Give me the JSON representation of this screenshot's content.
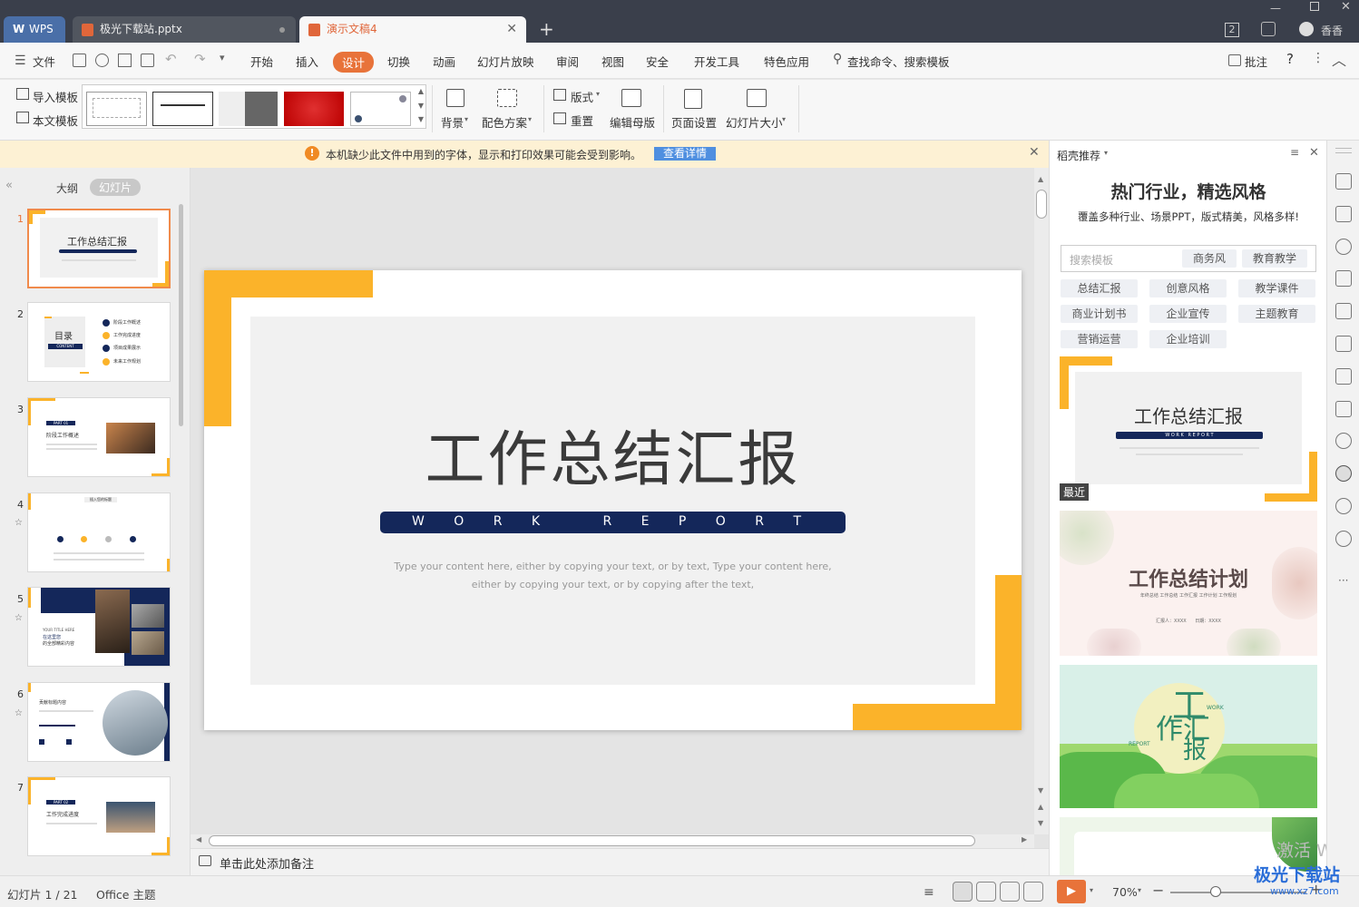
{
  "titlebar": {
    "wps": "WPS",
    "tab1": "极光下载站.pptx",
    "tab2": "演示文稿4",
    "user": "香香",
    "num": "2"
  },
  "menu": {
    "file": "文件",
    "items": [
      "开始",
      "插入",
      "设计",
      "切换",
      "动画",
      "幻灯片放映",
      "审阅",
      "视图",
      "安全",
      "开发工具",
      "特色应用"
    ],
    "search": "查找命令、搜索模板",
    "comment": "批注",
    "help": "?"
  },
  "ribbon": {
    "import": "导入模板",
    "this": "本文模板",
    "bg": "背景",
    "color": "配色方案",
    "layout": "版式",
    "reset": "重置",
    "master": "编辑母版",
    "pagesetup": "页面设置",
    "size": "幻灯片大小"
  },
  "warning": {
    "text": "本机缺少此文件中用到的字体，显示和打印效果可能会受到影响。",
    "link": "查看详情"
  },
  "leftpanel": {
    "outline": "大纲",
    "slides": "幻灯片",
    "nums": [
      "1",
      "2",
      "3",
      "4",
      "5",
      "6",
      "7"
    ]
  },
  "slide": {
    "title": "工作总结汇报",
    "subtitle": "W O R K   R E P O R T",
    "body1": "Type your content here, either by copying your text, or by text, Type your content here,",
    "body2": "either by copying your text, or by copying after the text,"
  },
  "thumbs": {
    "t1": "工作总结汇报",
    "t2": "目录",
    "t2sub": "CONTENT",
    "t2items": [
      "阶段工作概述",
      "工作完成进度",
      "项目成果展示",
      "未来工作规划"
    ],
    "t3": "阶段工作概述",
    "t3tag": "PART 01",
    "t4": "插入您的标题",
    "t6": "贡献标题内容",
    "t7": "工作完成进度",
    "t7tag": "PART 02",
    "t5a": "YOUR TITLE HERE",
    "t5b": "在这里您",
    "t5c": "的全部精彩内容"
  },
  "notes": "单击此处添加备注",
  "right": {
    "header": "稻壳推荐",
    "title": "热门行业，精选风格",
    "desc": "覆盖多种行业、场景PPT，版式精美，风格多样!",
    "search": "搜索模板",
    "tags": [
      "商务风",
      "教育教学",
      "总结汇报",
      "创意风格",
      "教学课件",
      "商业计划书",
      "企业宣传",
      "主题教育",
      "营销运营",
      "企业培训"
    ],
    "recent": "最近",
    "card1": "工作总结汇报",
    "card1sub": "W O R K   R E P O R T",
    "card2": "工作总结计划",
    "card2sub": "年终总结  工作总结  工作汇报  工作计划  工作规划",
    "card2meta": "汇报人：XXXX      日期：XXXX",
    "card3a": "工",
    "card3b": "作汇",
    "card3c": "报",
    "card3d": "WORK",
    "card3e": "REPORT"
  },
  "status": {
    "slide": "幻灯片 1 / 21",
    "theme": "Office 主题",
    "zoom": "70%"
  },
  "watermark": {
    "win": "激活 Wind",
    "site": "极光下载站",
    "url": "www.xz7.com"
  }
}
